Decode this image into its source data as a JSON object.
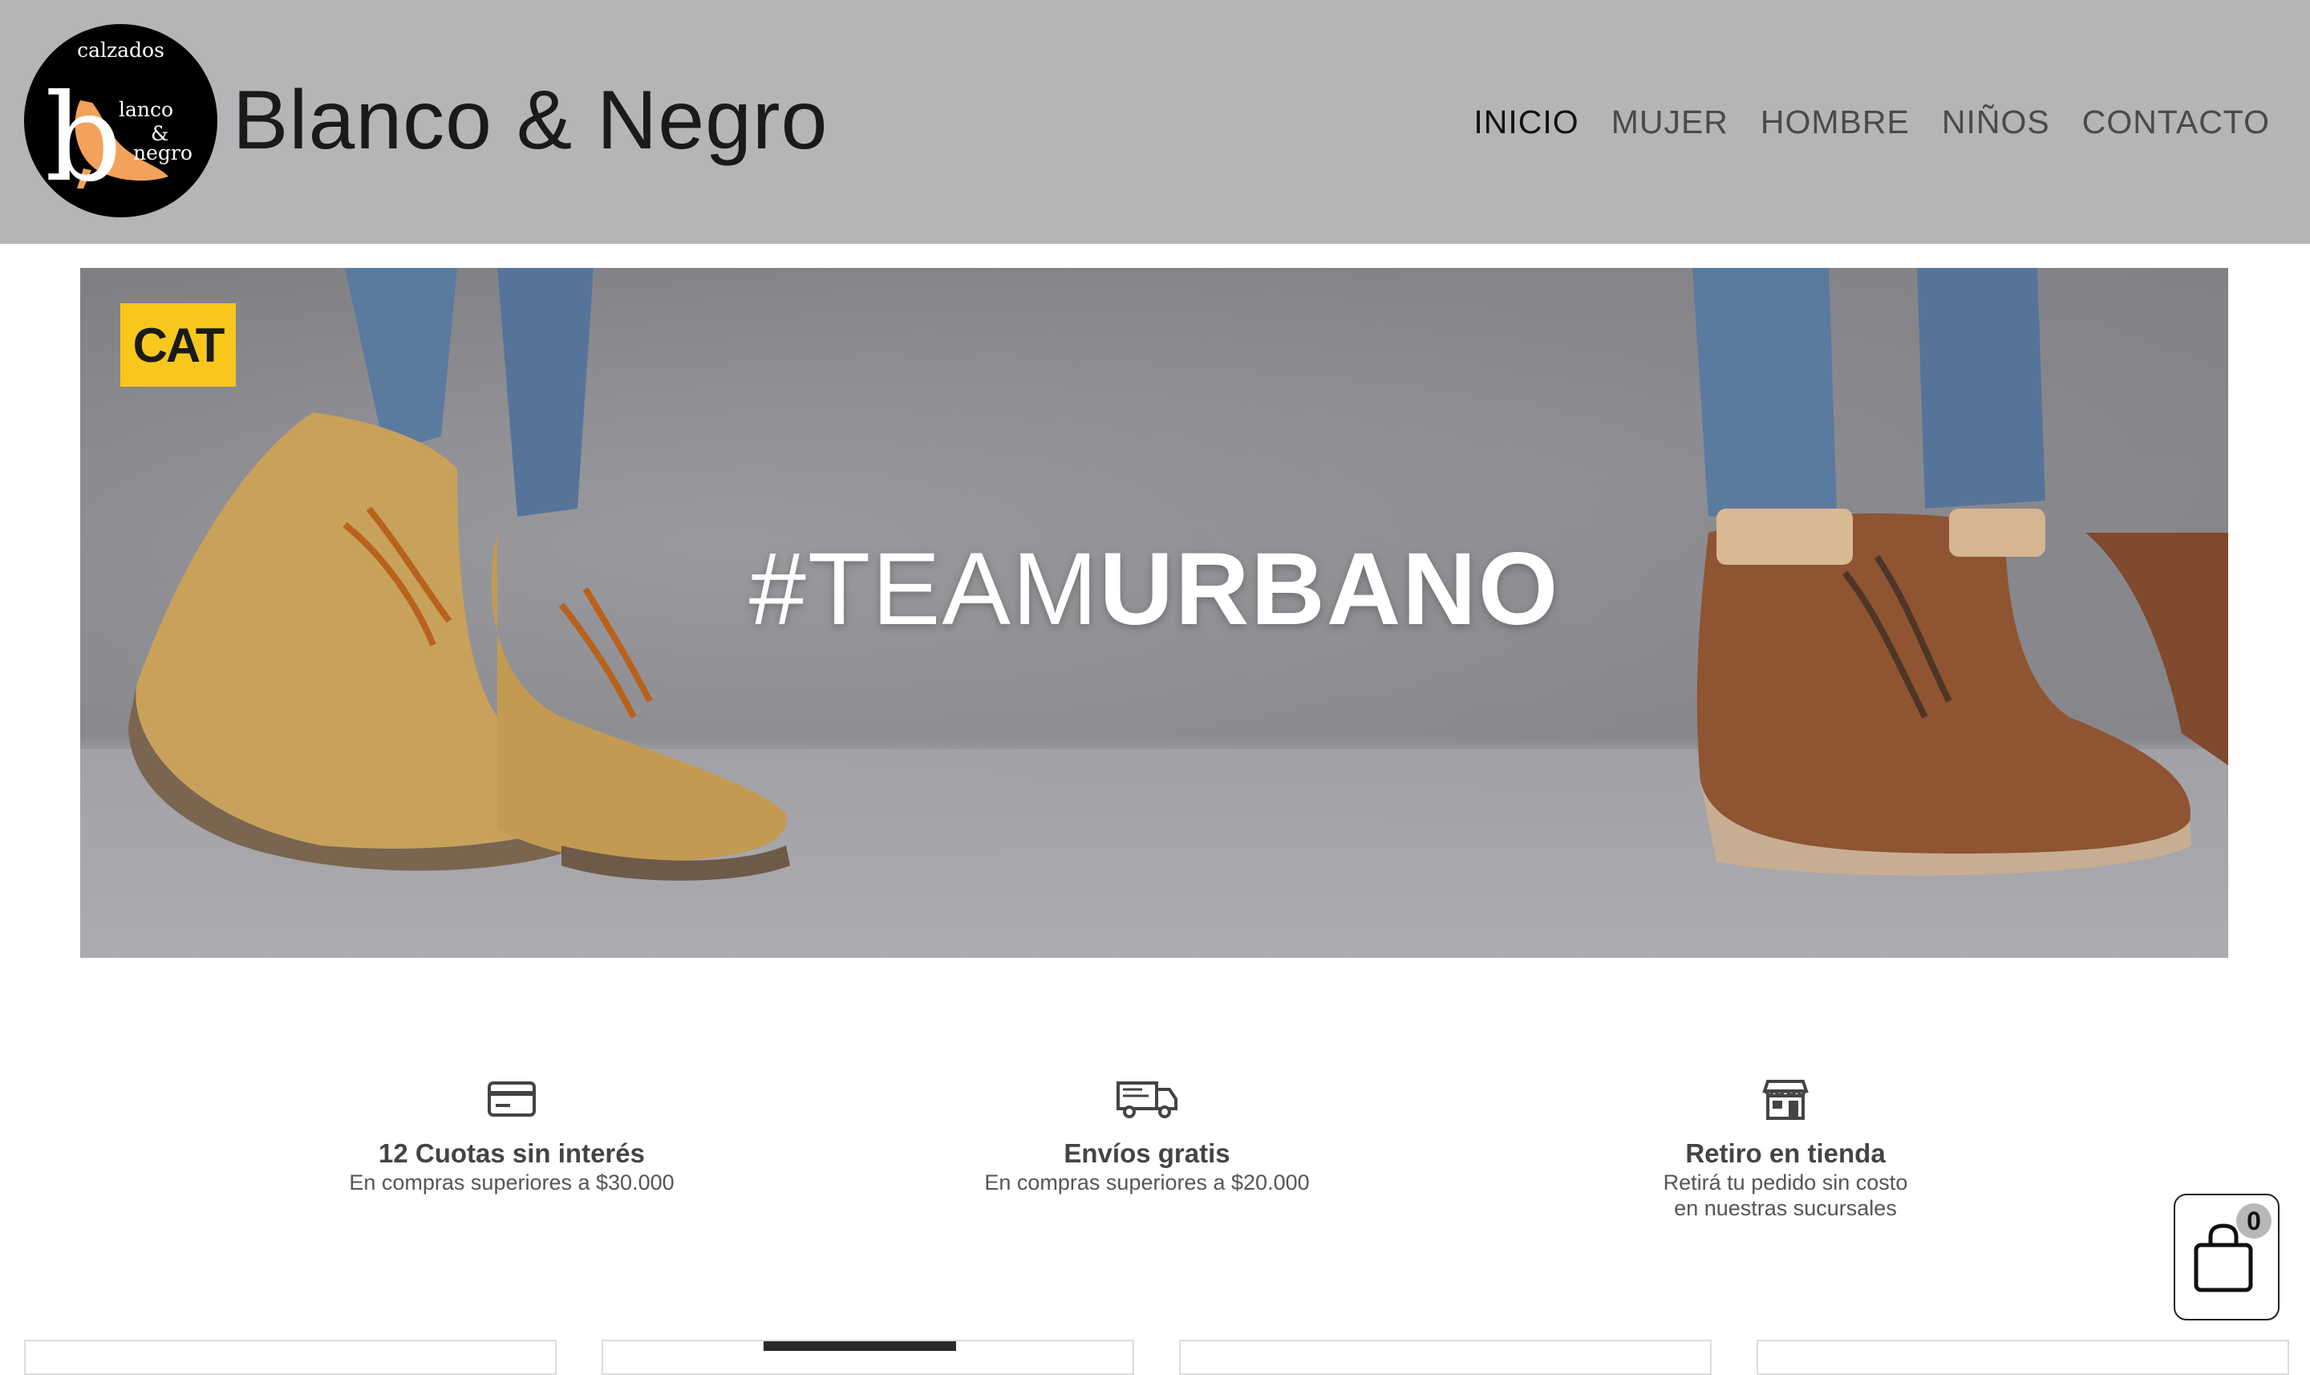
{
  "brand": {
    "logo": {
      "top_text": "calzados",
      "initial": "b",
      "line1": "lanco",
      "line2": "&",
      "line3": "negro"
    },
    "name": "Blanco & Negro"
  },
  "nav": {
    "items": [
      {
        "label": "INICIO",
        "active": true
      },
      {
        "label": "MUJER",
        "active": false
      },
      {
        "label": "HOMBRE",
        "active": false
      },
      {
        "label": "NIÑOS",
        "active": false
      },
      {
        "label": "CONTACTO",
        "active": false
      }
    ]
  },
  "hero": {
    "badge": "CAT",
    "headline_light": "#TEAM",
    "headline_bold": "URBANO"
  },
  "features": [
    {
      "icon": "credit-card-icon",
      "title": "12 Cuotas sin interés",
      "subtitle_lines": [
        "En compras superiores a $30.000"
      ]
    },
    {
      "icon": "delivery-truck-icon",
      "title": "Envíos gratis",
      "subtitle_lines": [
        "En compras superiores a $20.000"
      ]
    },
    {
      "icon": "store-icon",
      "title": "Retiro en tienda",
      "subtitle_lines": [
        "Retirá tu pedido sin costo",
        "en nuestras sucursales"
      ]
    }
  ],
  "cart": {
    "icon": "shopping-bag-icon",
    "count": "0"
  },
  "colors": {
    "header_bg": "#b4b5b7",
    "cat_yellow": "#f7c81b",
    "logo_accent": "#f2a25a"
  }
}
